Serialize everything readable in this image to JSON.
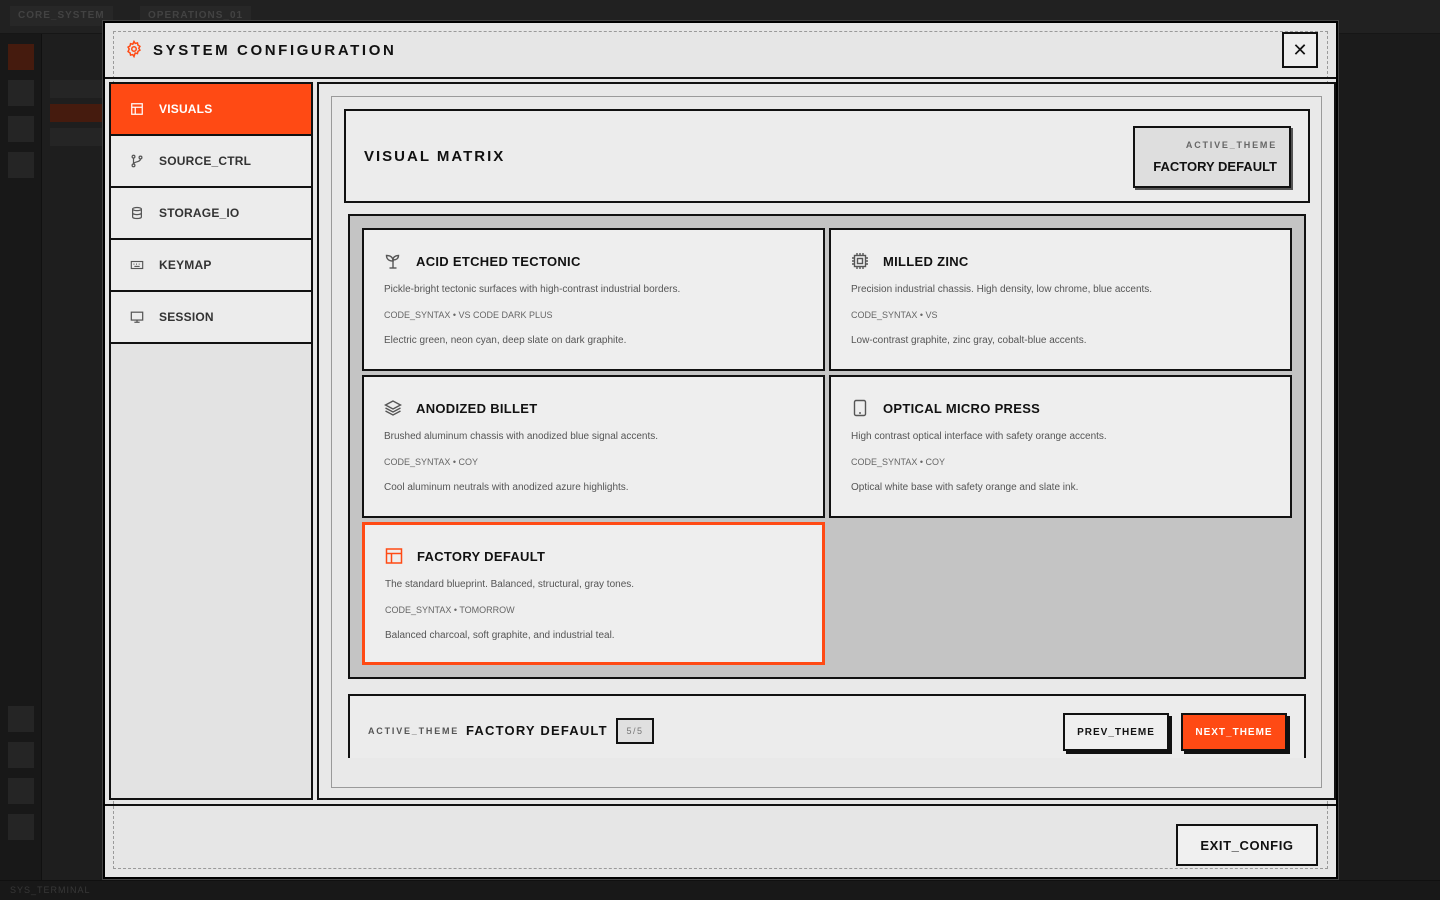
{
  "background": {
    "tabs": [
      "CORE_SYSTEM",
      "OPERATIONS_01"
    ],
    "status_label": "SYS_TERMINAL"
  },
  "modal": {
    "title": "SYSTEM CONFIGURATION",
    "header_icon": "gear-icon",
    "close_label": "✕",
    "sidebar": {
      "items": [
        {
          "label": "VISUALS",
          "icon": "layout-icon",
          "active": true
        },
        {
          "label": "SOURCE_CTRL",
          "icon": "branch-icon",
          "active": false
        },
        {
          "label": "STORAGE_IO",
          "icon": "database-icon",
          "active": false
        },
        {
          "label": "KEYMAP",
          "icon": "keyboard-icon",
          "active": false
        },
        {
          "label": "SESSION",
          "icon": "monitor-icon",
          "active": false
        }
      ]
    },
    "visual_matrix": {
      "title": "VISUAL MATRIX",
      "active_theme_label": "ACTIVE_THEME",
      "active_theme_value": "FACTORY DEFAULT"
    },
    "themes": [
      {
        "title": "ACID ETCHED TECTONIC",
        "icon": "sprout-icon",
        "description": "Pickle-bright tectonic surfaces with high-contrast industrial borders.",
        "syntax": "CODE_SYNTAX • VS CODE DARK PLUS",
        "colors": "Electric green, neon cyan, deep slate on dark graphite."
      },
      {
        "title": "MILLED ZINC",
        "icon": "cpu-icon",
        "description": "Precision industrial chassis. High density, low chrome, blue accents.",
        "syntax": "CODE_SYNTAX • VS",
        "colors": "Low-contrast graphite, zinc gray, cobalt-blue accents."
      },
      {
        "title": "ANODIZED BILLET",
        "icon": "layers-icon",
        "description": "Brushed aluminum chassis with anodized blue signal accents.",
        "syntax": "CODE_SYNTAX • COY",
        "colors": "Cool aluminum neutrals with anodized azure highlights."
      },
      {
        "title": "OPTICAL MICRO PRESS",
        "icon": "tablet-icon",
        "description": "High contrast optical interface with safety orange accents.",
        "syntax": "CODE_SYNTAX • COY",
        "colors": "Optical white base with safety orange and slate ink."
      },
      {
        "title": "FACTORY DEFAULT",
        "icon": "layout-icon",
        "description": "The standard blueprint. Balanced, structural, gray tones.",
        "syntax": "CODE_SYNTAX • TOMORROW",
        "colors": "Balanced charcoal, soft graphite, and industrial teal.",
        "selected": true
      }
    ],
    "footer_bar": {
      "active_theme_label": "ACTIVE_THEME",
      "active_theme_value": "FACTORY DEFAULT",
      "count": "5/5",
      "prev_label": "PREV_THEME",
      "next_label": "NEXT_THEME"
    },
    "exit_label": "EXIT_CONFIG"
  },
  "colors": {
    "accent": "#ff4a14",
    "panel": "#e6e6e6",
    "border": "#111111"
  }
}
